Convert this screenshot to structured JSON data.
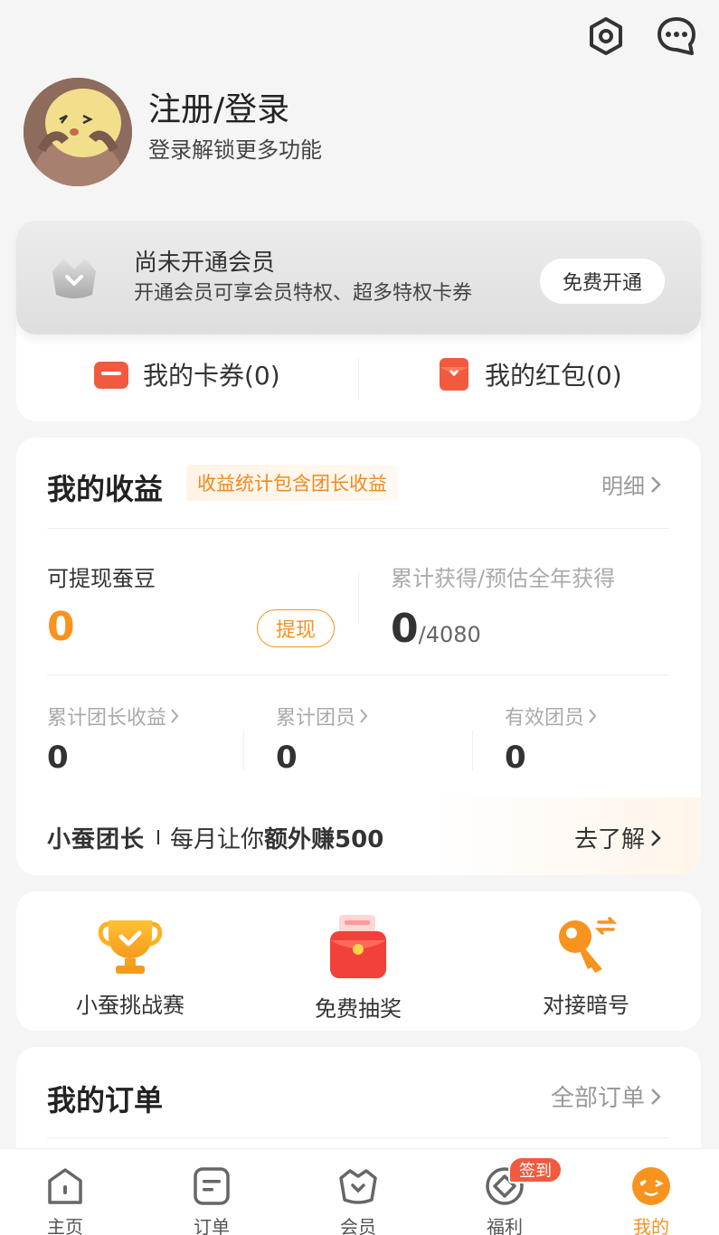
{
  "header": {
    "settings_icon": "settings-hex-icon",
    "message_icon": "message-bubble-icon"
  },
  "profile": {
    "title": "注册/登录",
    "subtitle": "登录解锁更多功能"
  },
  "member": {
    "title": "尚未开通会员",
    "desc": "开通会员可享会员特权、超多特权卡券",
    "button": "免费开通"
  },
  "coupons": {
    "cards": "我的卡券(0)",
    "redpacket": "我的红包(0)"
  },
  "earnings": {
    "title": "我的收益",
    "tag": "收益统计包含团长收益",
    "detail": "明细",
    "withdraw_label": "可提现蚕豆",
    "withdraw_value": "0",
    "withdraw_button": "提现",
    "total_label": "累计获得/预估全年获得",
    "total_value": "0",
    "total_max": "/4080",
    "stats": [
      {
        "label": "累计团长收益",
        "value": "0"
      },
      {
        "label": "累计团员",
        "value": "0"
      },
      {
        "label": "有效团员",
        "value": "0"
      }
    ],
    "leader": {
      "brand": "小蚕团长",
      "text_prefix": "每月让你",
      "text_bold": "额外赚500",
      "go": "去了解"
    }
  },
  "quick": [
    {
      "label": "小蚕挑战赛",
      "icon": "trophy-icon"
    },
    {
      "label": "免费抽奖",
      "icon": "red-envelope-icon"
    },
    {
      "label": "对接暗号",
      "icon": "key-icon"
    }
  ],
  "orders": {
    "title": "我的订单",
    "all": "全部订单"
  },
  "tabs": [
    {
      "label": "主页",
      "icon": "home-icon"
    },
    {
      "label": "订单",
      "icon": "order-icon"
    },
    {
      "label": "会员",
      "icon": "member-icon"
    },
    {
      "label": "福利",
      "icon": "welfare-icon"
    },
    {
      "label": "我的",
      "icon": "me-icon"
    }
  ],
  "sign_badge": "签到",
  "colors": {
    "accent": "#f7931e",
    "badge": "#f25a3f",
    "background": "#f5f5f5"
  }
}
